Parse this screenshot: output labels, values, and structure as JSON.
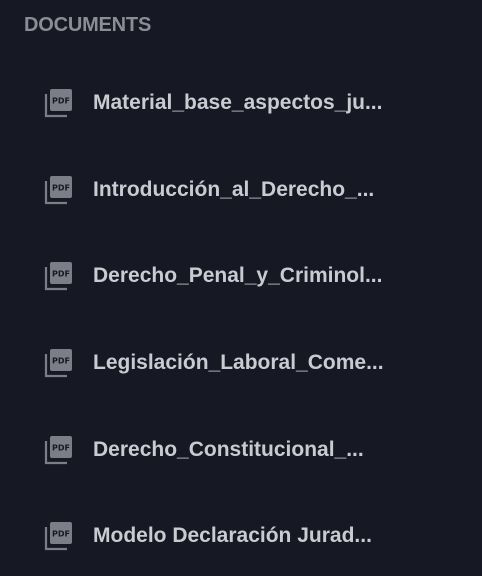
{
  "section": {
    "title": "DOCUMENTS"
  },
  "documents": [
    {
      "name": "Material_base_aspectos_ju...",
      "icon": "pdf-file-icon"
    },
    {
      "name": "Introducción_al_Derecho_...",
      "icon": "pdf-file-icon"
    },
    {
      "name": "Derecho_Penal_y_Criminol...",
      "icon": "pdf-file-icon"
    },
    {
      "name": "Legislación_Laboral_Come...",
      "icon": "pdf-file-icon"
    },
    {
      "name": "Derecho_Constitucional_...",
      "icon": "pdf-file-icon"
    },
    {
      "name": "Modelo Declaración Jurad...",
      "icon": "pdf-file-icon"
    }
  ],
  "colors": {
    "background": "#161823",
    "title": "#8a8d96",
    "item_text": "#c9cbd1",
    "icon": "#7b7e86"
  }
}
